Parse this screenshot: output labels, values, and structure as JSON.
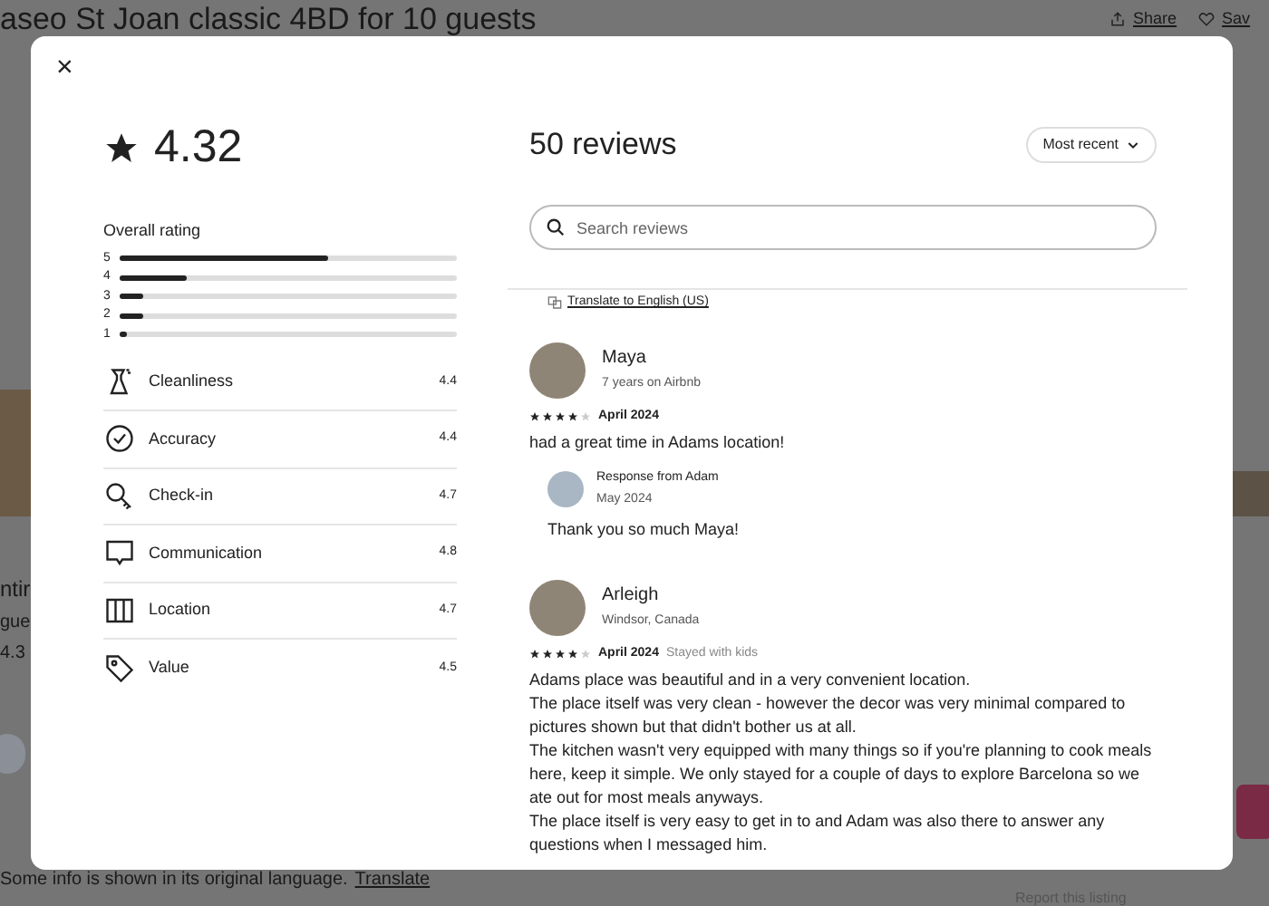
{
  "page": {
    "title": "aseo St Joan classic 4BD for 10 guests",
    "share": "Share",
    "save": "Sav",
    "side_texts": [
      "ntir",
      "gue",
      "4.3"
    ],
    "footer_text": "Some info is shown in its original language.",
    "footer_link": "Translate",
    "report": "Report this listing"
  },
  "modal": {
    "close": "×",
    "rating": "4.32",
    "overall_label": "Overall rating",
    "distribution": [
      {
        "label": "5",
        "level": 0.62
      },
      {
        "label": "4",
        "level": 0.2
      },
      {
        "label": "3",
        "level": 0.07
      },
      {
        "label": "2",
        "level": 0.07
      },
      {
        "label": "1",
        "level": 0.02
      }
    ],
    "categories": [
      {
        "kind": "cleanliness",
        "label": "Cleanliness",
        "score": "4.4"
      },
      {
        "kind": "accuracy",
        "label": "Accuracy",
        "score": "4.4"
      },
      {
        "kind": "checkin",
        "label": "Check-in",
        "score": "4.7"
      },
      {
        "kind": "communication",
        "label": "Communication",
        "score": "4.8"
      },
      {
        "kind": "location",
        "label": "Location",
        "score": "4.7"
      },
      {
        "kind": "value",
        "label": "Value",
        "score": "4.5"
      }
    ],
    "reviews_title": "50 reviews",
    "sort": "Most recent",
    "search": {
      "placeholder": "Search reviews"
    },
    "translate": "Translate to English (US)",
    "reviews": [
      {
        "name": "Maya",
        "subtitle": "7 years on Airbnb",
        "stars": 4,
        "date": "April 2024",
        "paragraphs": [
          "had a great time in Adams location!"
        ],
        "response": {
          "title": "Response from Adam",
          "date": "May 2024",
          "text": "Thank you so much Maya!"
        }
      },
      {
        "name": "Arleigh",
        "subtitle": "Windsor, Canada",
        "stars": 4,
        "date": "April 2024",
        "tag": "Stayed with kids",
        "paragraphs": [
          "Adams place was beautiful and in a very convenient location.",
          "The place itself was very clean - however the decor was very minimal compared to pictures shown but that didn't bother us at all.",
          "The kitchen wasn't very equipped with many things so if you're planning to cook meals here, keep it simple. We only stayed for a couple of days to explore Barcelona so we ate out for most meals anyways.",
          "The place itself is very easy to get in to and Adam was also there to answer any questions when I messaged him."
        ]
      }
    ]
  }
}
